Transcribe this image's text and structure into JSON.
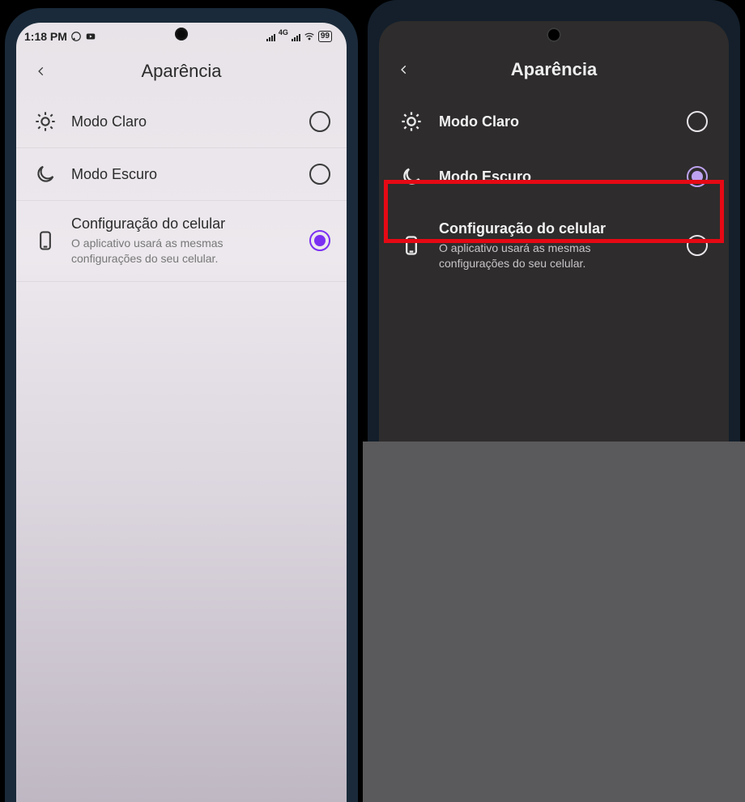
{
  "status": {
    "time": "1:18 PM",
    "whatsapp_icon": "whatsapp",
    "youtube_icon": "youtube",
    "network_label": "4G",
    "wifi_icon": "wifi",
    "battery_pct": "99"
  },
  "light": {
    "title": "Aparência",
    "options": [
      {
        "id": "light",
        "label": "Modo Claro",
        "subtitle": "",
        "selected": false
      },
      {
        "id": "dark",
        "label": "Modo Escuro",
        "subtitle": "",
        "selected": false
      },
      {
        "id": "system",
        "label": "Configuração do celular",
        "subtitle": "O aplicativo usará as mesmas configurações do seu celular.",
        "selected": true
      }
    ]
  },
  "dark": {
    "title": "Aparência",
    "options": [
      {
        "id": "light",
        "label": "Modo Claro",
        "subtitle": "",
        "selected": false
      },
      {
        "id": "dark",
        "label": "Modo Escuro",
        "subtitle": "",
        "selected": true
      },
      {
        "id": "system",
        "label": "Configuração do celular",
        "subtitle": "O aplicativo usará as mesmas configurações do seu celular.",
        "selected": false
      }
    ],
    "highlight_option": "dark"
  },
  "colors": {
    "accent": "#7b2ff2",
    "highlight": "#e50914"
  }
}
